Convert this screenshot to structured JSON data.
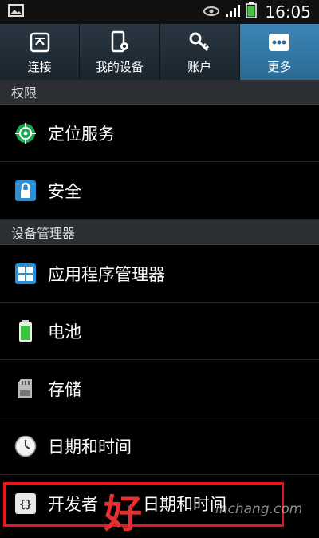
{
  "statusbar": {
    "time": "16:05",
    "icons": [
      "image-icon",
      "eye-icon",
      "signal-icon",
      "battery-icon"
    ]
  },
  "tabs": [
    {
      "label": "连接",
      "icon": "connect-icon",
      "active": false
    },
    {
      "label": "我的设备",
      "icon": "device-icon",
      "active": false
    },
    {
      "label": "账户",
      "icon": "key-icon",
      "active": false
    },
    {
      "label": "更多",
      "icon": "more-icon",
      "active": true
    }
  ],
  "sections": {
    "permissions": "权限",
    "device_manager": "设备管理器"
  },
  "items": {
    "location": "定位服务",
    "security": "安全",
    "app_manager": "应用程序管理器",
    "battery": "电池",
    "storage": "存储",
    "datetime": "日期和时间",
    "developer": "开发者",
    "developer_overlay": "日期和时间"
  },
  "watermark": {
    "char": "好",
    "url": "inchang.com"
  },
  "colors": {
    "active_tab": "#3b86b6",
    "highlight_border": "#e01818",
    "location_icon": "#1fa653",
    "security_icon": "#2a8fd4",
    "battery_icon": "#3cc23c"
  }
}
